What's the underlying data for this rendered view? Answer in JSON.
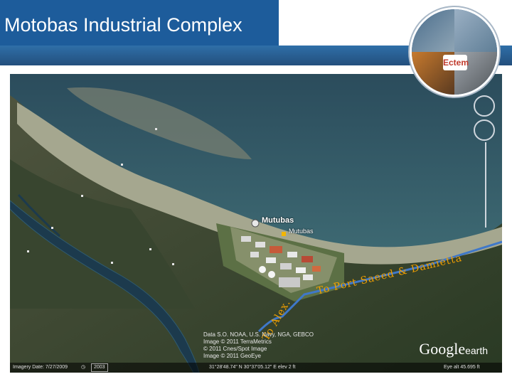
{
  "slide": {
    "title": "Motobas Industrial Complex",
    "colors": {
      "title_band": "#1d5c9b",
      "route_label": "#f2a000",
      "route_line": "#3f78c9"
    }
  },
  "badge": {
    "logo_text": "Ectem",
    "icon": "company-logo-collage"
  },
  "map": {
    "place_label": "Mutubas",
    "place_sublabel": "Mutubas",
    "route_to_port": "To Port Saeed & Damietta",
    "route_to_alex": "To Alex.",
    "credits": [
      "Data S.O. NOAA, U.S. Navy, NGA, GEBCO",
      "Image © 2011 TerraMetrics",
      "© 2011 Cnes/Spot Image",
      "Image © 2011 GeoEye"
    ],
    "logo": {
      "brand": "Google",
      "suffix": "earth"
    },
    "status": {
      "imagery_date": "Imagery Date: 7/27/2009",
      "year": "2003",
      "coords": "31°28'48.74\" N  30°37'05.12\" E  elev   2 ft",
      "eye_alt": "Eye alt   45.695 ft"
    }
  }
}
